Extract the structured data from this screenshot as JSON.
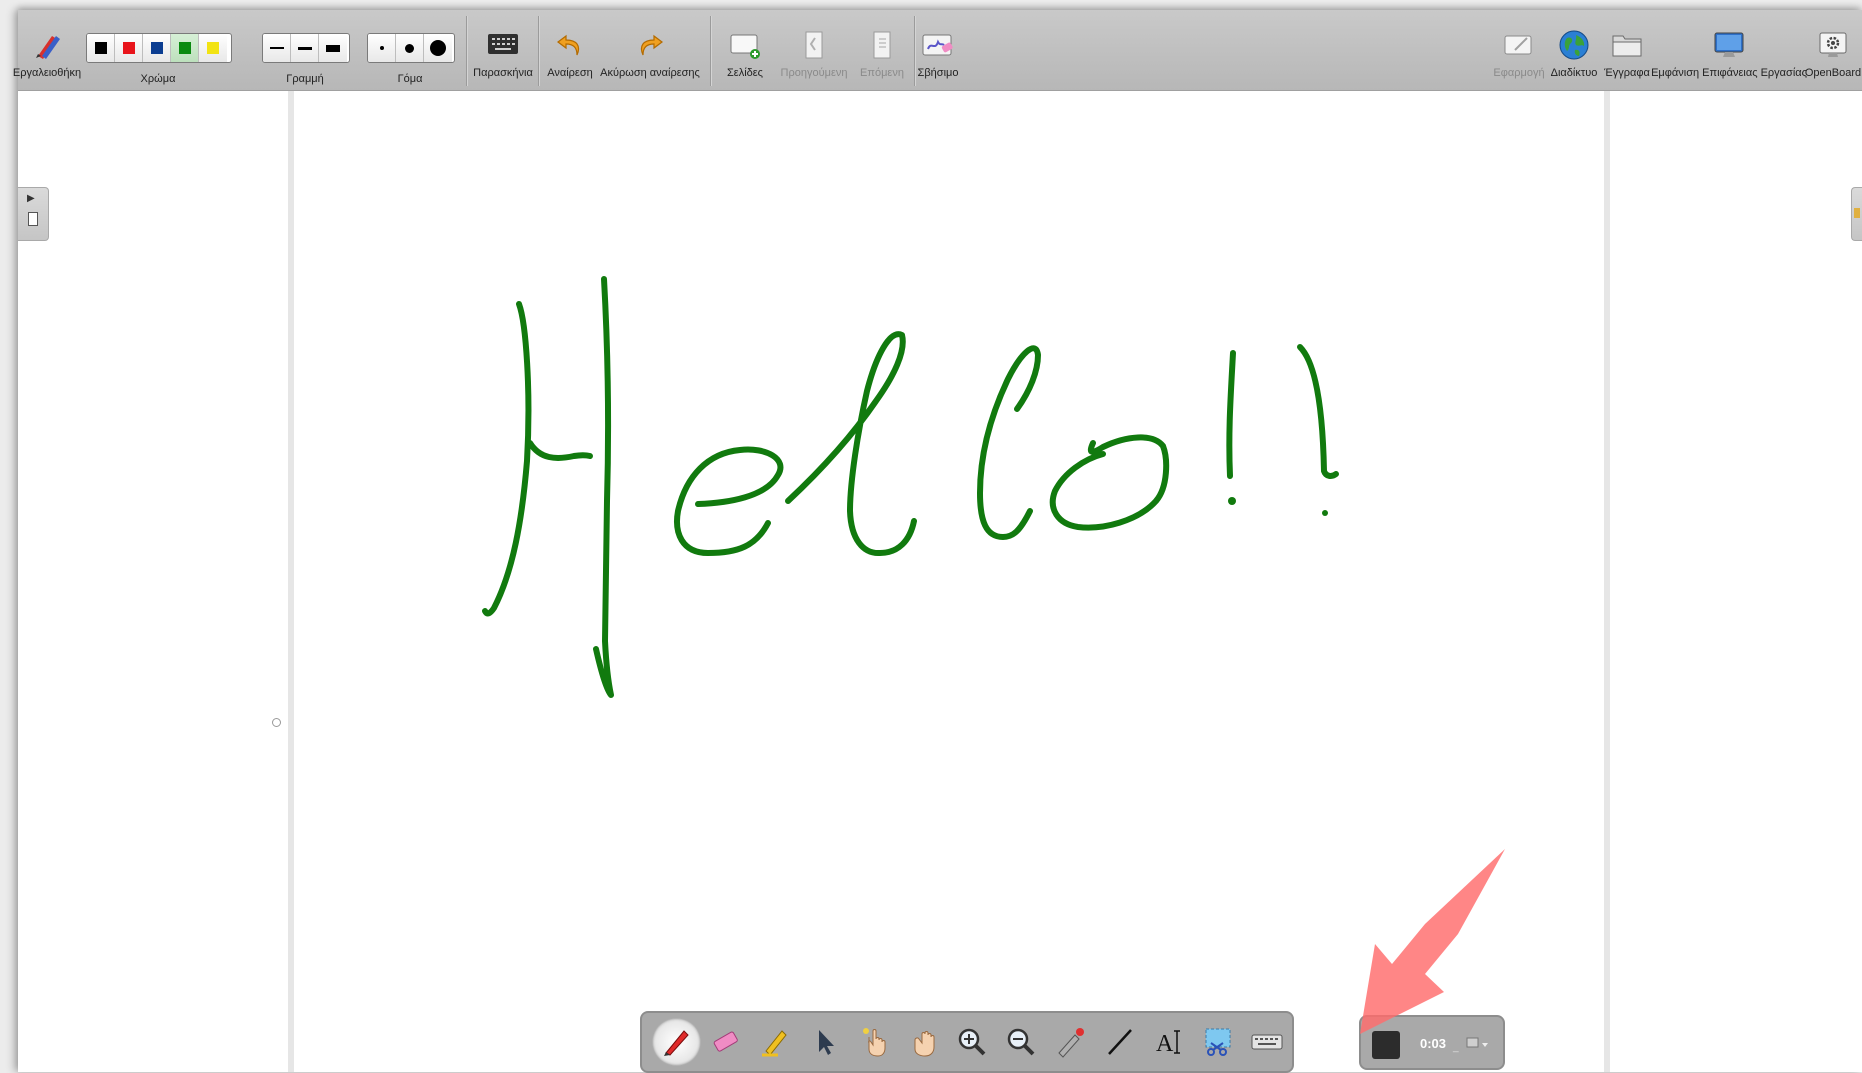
{
  "toolbar": {
    "left": [
      {
        "id": "tools",
        "label": "Εργαλειοθήκη",
        "icon": "pen-case-icon"
      },
      {
        "id": "background",
        "label": "Παρασκήνια",
        "icon": "background-icon"
      },
      {
        "id": "undo",
        "label": "Αναίρεση",
        "icon": "undo-icon"
      },
      {
        "id": "redo",
        "label": "Ακύρωση αναίρεσης",
        "icon": "redo-icon"
      },
      {
        "id": "pages",
        "label": "Σελίδες",
        "icon": "add-page-icon"
      },
      {
        "id": "previous",
        "label": "Προηγούμενη",
        "icon": "previous-page-icon",
        "disabled": true
      },
      {
        "id": "next",
        "label": "Επόμενη",
        "icon": "next-page-icon",
        "disabled": true
      },
      {
        "id": "erase",
        "label": "Σβήσιμο",
        "icon": "clear-page-icon"
      }
    ],
    "color_label": "Χρώμα",
    "colors": [
      "#000000",
      "#e8141b",
      "#0b3d91",
      "#0a8a10",
      "#f2e313"
    ],
    "line_label": "Γραμμή",
    "eraser_label": "Γόμα",
    "right": [
      {
        "id": "app",
        "label": "Εφαρμογή",
        "icon": "application-icon",
        "disabled": true
      },
      {
        "id": "web",
        "label": "Διαδίκτυο",
        "icon": "globe-icon"
      },
      {
        "id": "documents",
        "label": "Έγγραφα",
        "icon": "folder-icon"
      },
      {
        "id": "desktop",
        "label": "Εμφάνιση Επιφάνειας Εργασίας",
        "icon": "desktop-icon"
      },
      {
        "id": "openboard",
        "label": "OpenBoard",
        "icon": "settings-icon"
      }
    ]
  },
  "board": {
    "ink_color": "#117a0e",
    "handwriting": "Hello!!"
  },
  "stylus_palette": [
    {
      "id": "pen",
      "icon": "pen-icon",
      "active": true
    },
    {
      "id": "eraser",
      "icon": "eraser-icon"
    },
    {
      "id": "marker",
      "icon": "highlighter-icon"
    },
    {
      "id": "selector",
      "icon": "pointer-icon"
    },
    {
      "id": "play",
      "icon": "interact-hand-icon"
    },
    {
      "id": "hand",
      "icon": "pan-hand-icon"
    },
    {
      "id": "zoom_in",
      "icon": "zoom-in-icon"
    },
    {
      "id": "zoom_out",
      "icon": "zoom-out-icon"
    },
    {
      "id": "laser",
      "icon": "laser-pointer-icon"
    },
    {
      "id": "line",
      "icon": "line-icon"
    },
    {
      "id": "text",
      "icon": "text-icon"
    },
    {
      "id": "capture",
      "icon": "capture-icon"
    },
    {
      "id": "keyboard",
      "icon": "keyboard-icon"
    }
  ],
  "podcast": {
    "timer": "0:03"
  }
}
